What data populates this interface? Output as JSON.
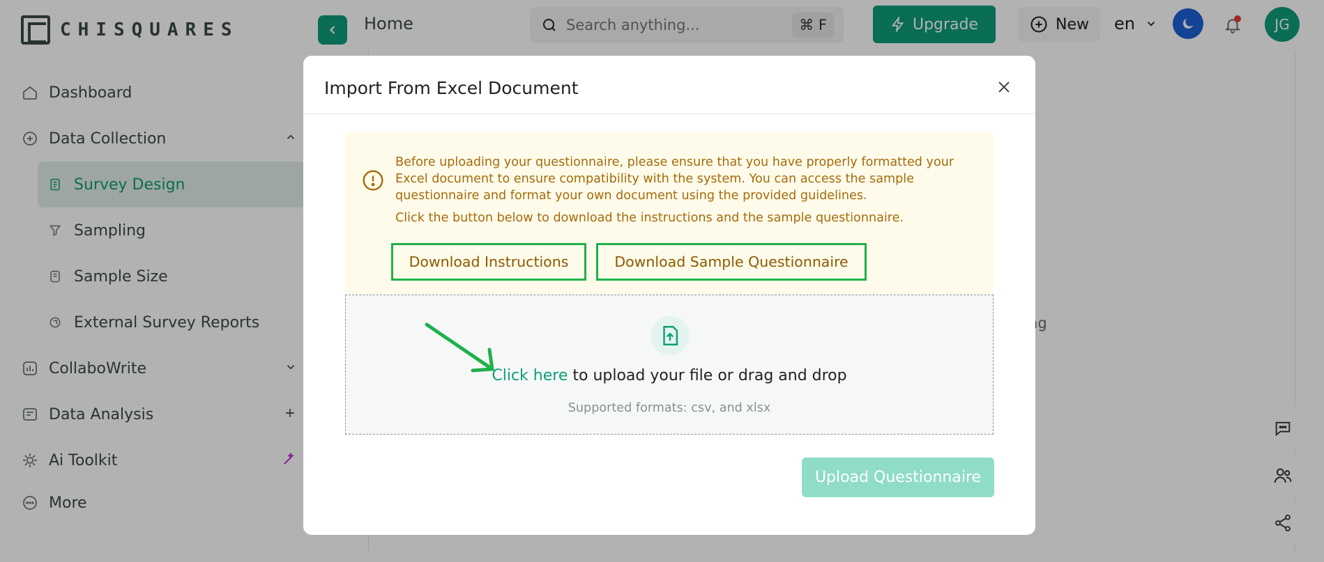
{
  "app": {
    "brand": "CHISQUARES"
  },
  "sidebar": {
    "items": [
      {
        "label": "Dashboard",
        "icon": "home-icon"
      },
      {
        "label": "Data Collection",
        "icon": "data-collection-icon"
      },
      {
        "label": "Survey Design",
        "icon": "survey-design-icon"
      },
      {
        "label": "Sampling",
        "icon": "sampling-icon"
      },
      {
        "label": "Sample Size",
        "icon": "sample-size-icon"
      },
      {
        "label": "External Survey Reports",
        "icon": "external-reports-icon"
      },
      {
        "label": "CollaboWrite",
        "icon": "collabowrite-icon"
      },
      {
        "label": "Data Analysis",
        "icon": "data-analysis-icon"
      },
      {
        "label": "Ai Toolkit",
        "icon": "ai-toolkit-icon"
      },
      {
        "label": "More",
        "icon": "more-icon"
      }
    ]
  },
  "header": {
    "page_title": "Home",
    "search_placeholder": "Search anything...",
    "search_shortcut": "⌘ F",
    "upgrade_label": "Upgrade",
    "new_label": "New",
    "language": "en",
    "avatar_initials": "JG"
  },
  "background": {
    "partial_text": "sting"
  },
  "modal": {
    "title": "Import From Excel Document",
    "notice_text": "Before uploading your questionnaire, please ensure that you have properly formatted your Excel document to ensure compatibility with the system. You can access the sample questionnaire and format your own document using the provided guidelines.",
    "notice_text2": "Click the button below to download the instructions and the sample questionnaire.",
    "download_instructions_label": "Download Instructions",
    "download_sample_label": "Download Sample Questionnaire",
    "dropzone": {
      "link_text": "Click here",
      "rest_text": " to upload your file or drag and drop",
      "formats": "Supported formats: csv, and xlsx"
    },
    "upload_label": "Upload Questionnaire"
  },
  "colors": {
    "accent": "#0f9d7a",
    "highlight_border": "#1fb04a",
    "notice_bg": "#fffbea",
    "notice_text": "#a56b0c",
    "upload_disabled": "#8fdcc7"
  }
}
